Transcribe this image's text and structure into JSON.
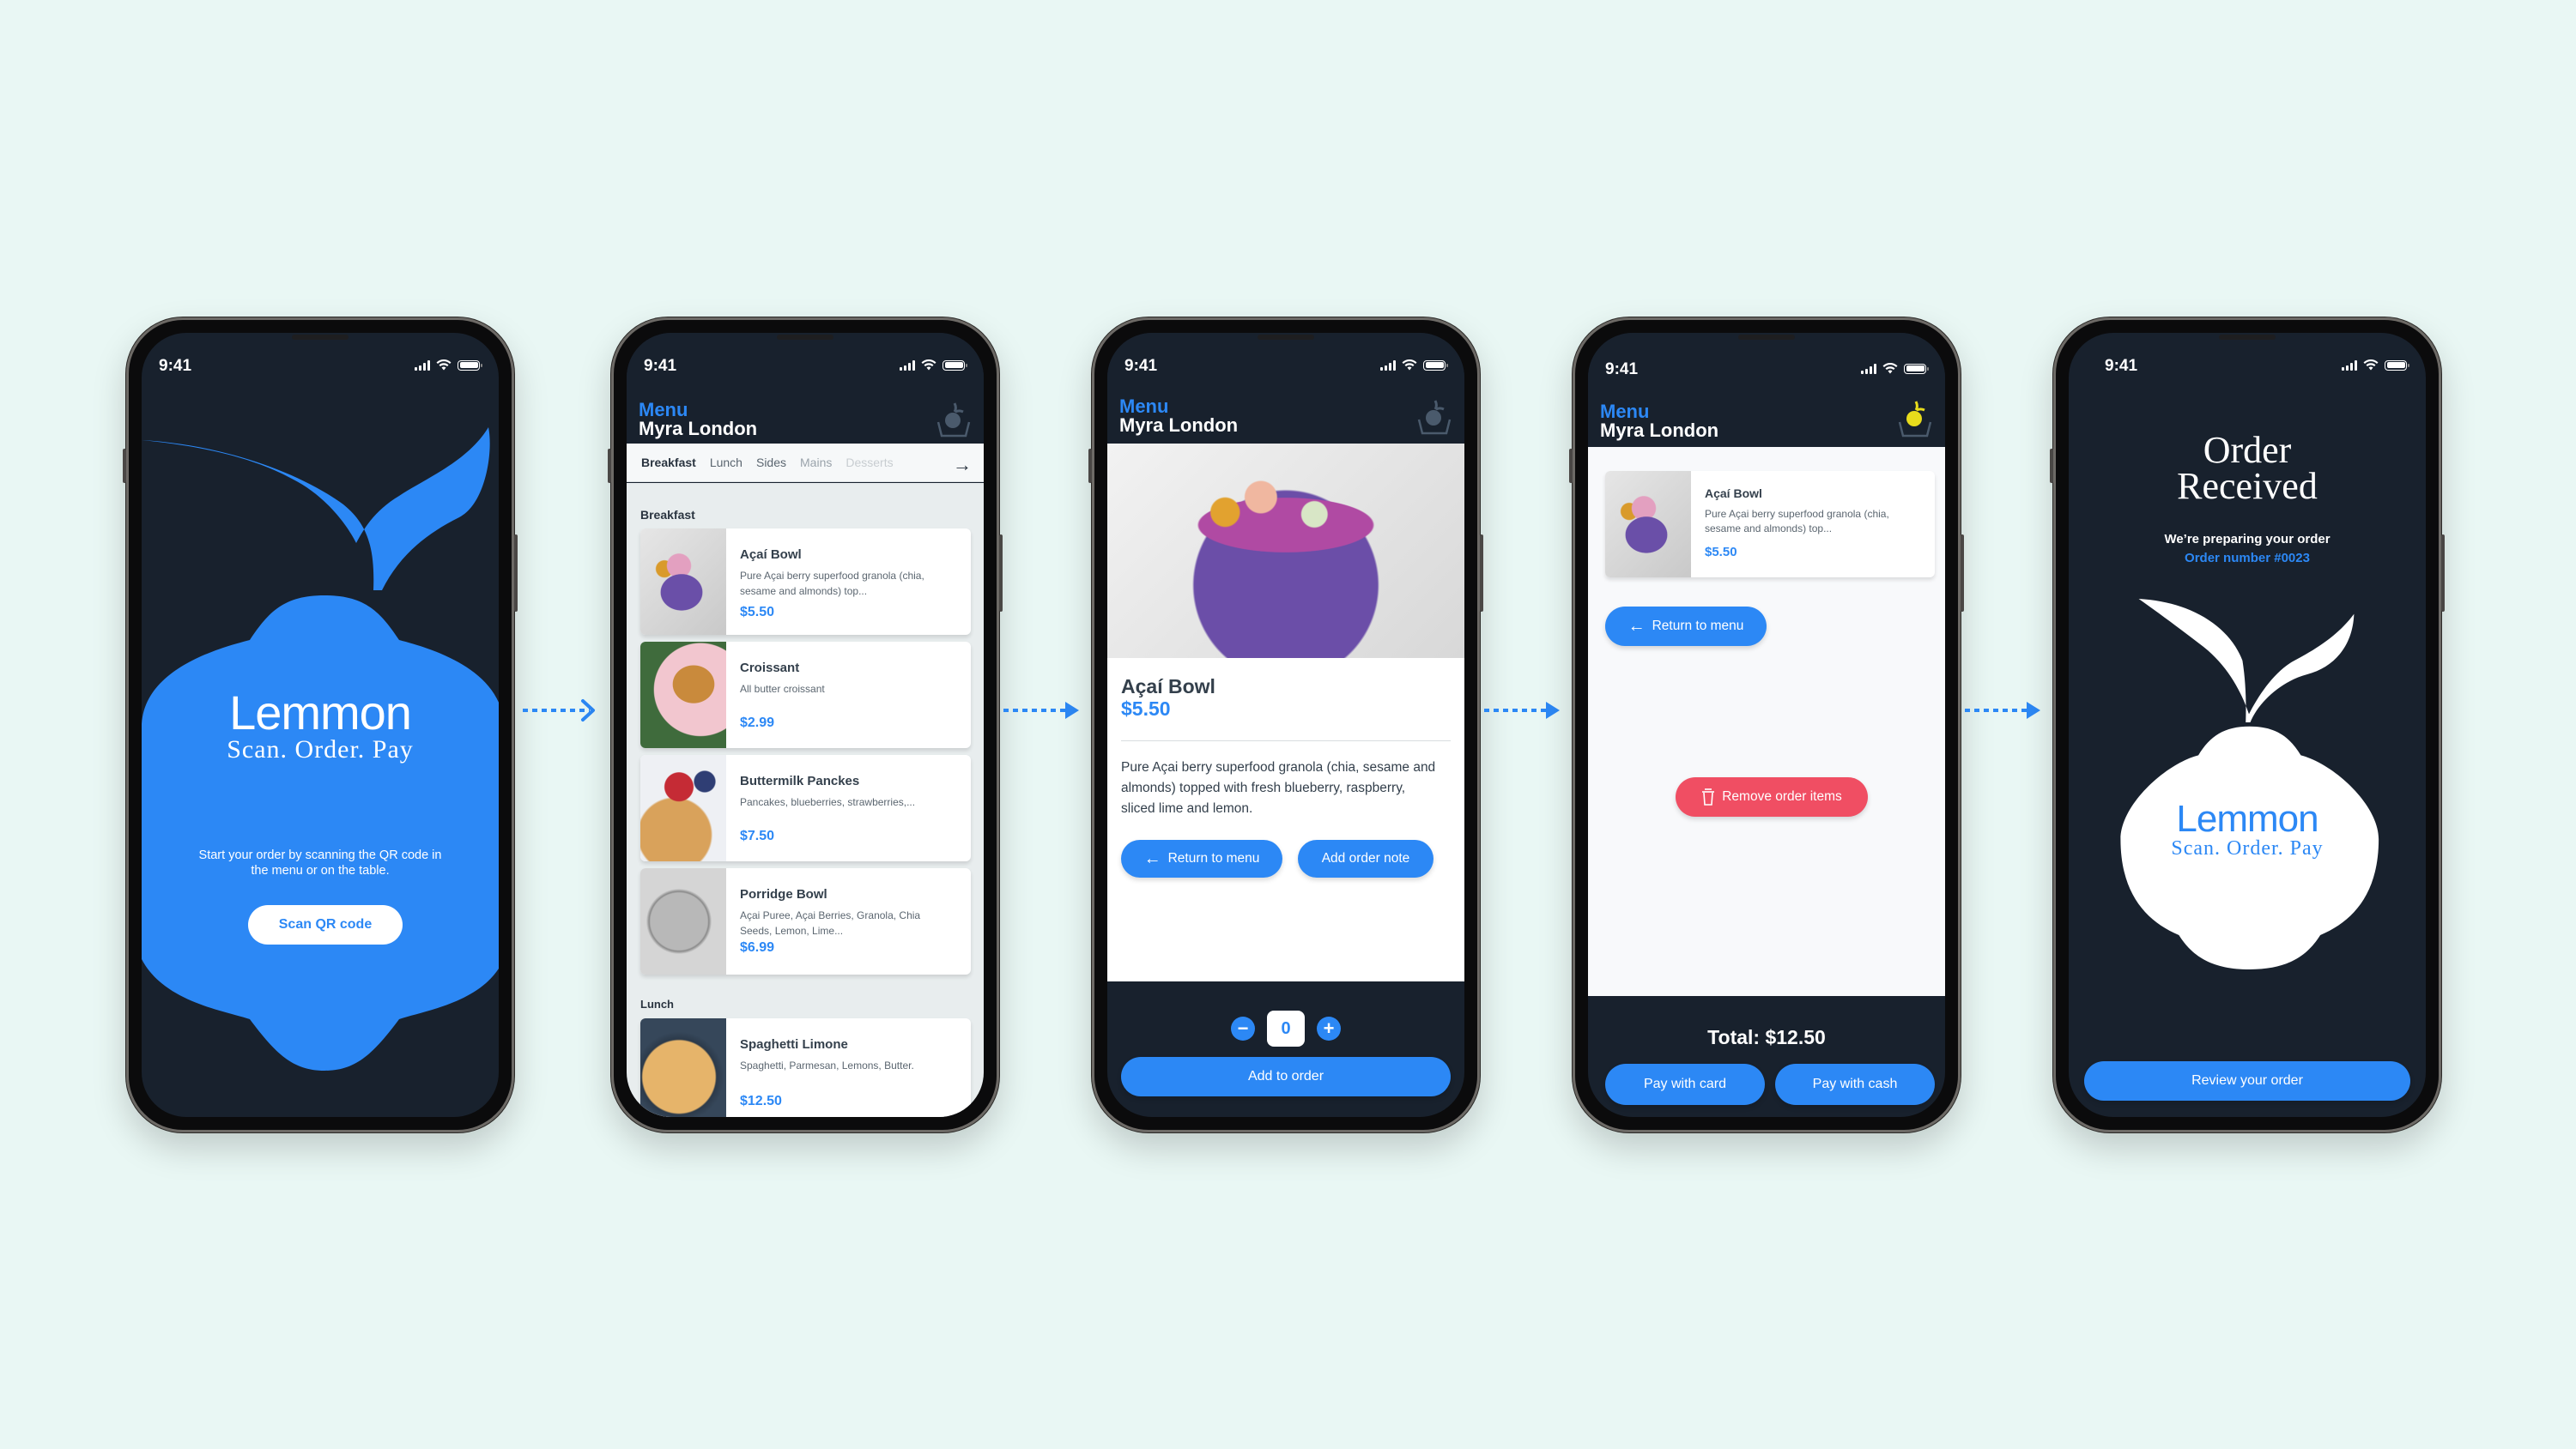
{
  "app": {
    "brand_name": "Lemmon",
    "tagline": "Scan. Order. Pay",
    "accent_color": "#2c88f5",
    "danger_color": "#f04e63",
    "dark_color": "#18212d",
    "background_color": "#e9f7f4"
  },
  "status_bar": {
    "time": "9:41",
    "icons": [
      "signal-icon",
      "wifi-icon",
      "battery-icon"
    ]
  },
  "header": {
    "menu_label": "Menu",
    "restaurant_name": "Myra London",
    "cart_icon": "basket-lemon-icon"
  },
  "screen_welcome": {
    "instructions": "Start your order by scanning the QR code in the menu or on the table.",
    "scan_button": "Scan QR code"
  },
  "screen_menu": {
    "tabs": [
      {
        "label": "Breakfast",
        "active": true
      },
      {
        "label": "Lunch",
        "active": false
      },
      {
        "label": "Sides",
        "active": false
      },
      {
        "label": "Mains",
        "active": false
      },
      {
        "label": "Desserts",
        "active": false
      }
    ],
    "tabs_next_icon": "arrow-right-icon",
    "sections": [
      {
        "title": "Breakfast",
        "items": [
          {
            "name": "Açaí Bowl",
            "description": "Pure Açai berry superfood granola (chia, sesame and almonds) top...",
            "price": "$5.50"
          },
          {
            "name": "Croissant",
            "description": "All butter croissant",
            "price": "$2.99"
          },
          {
            "name": "Buttermilk Panckes",
            "description": "Pancakes, blueberries, strawberries,...",
            "price": "$7.50"
          },
          {
            "name": "Porridge Bowl",
            "description": "Açai Puree, Açai Berries, Granola, Chia Seeds, Lemon, Lime...",
            "price": "$6.99"
          }
        ]
      },
      {
        "title": "Lunch",
        "items": [
          {
            "name": "Spaghetti Limone",
            "description": "Spaghetti, Parmesan, Lemons, Butter.",
            "price": "$12.50"
          }
        ]
      }
    ]
  },
  "screen_item": {
    "name": "Açaí Bowl",
    "price": "$5.50",
    "description": "Pure Açai berry superfood granola (chia, sesame and almonds) topped with fresh blueberry, raspberry, sliced lime and lemon.",
    "return_button": "Return to menu",
    "note_button": "Add order note",
    "quantity": "0",
    "add_button": "Add to order"
  },
  "screen_cart": {
    "item": {
      "name": "Açaí Bowl",
      "description": "Pure Açai berry superfood granola (chia, sesame and almonds) top...",
      "price": "$5.50"
    },
    "return_button": "Return to menu",
    "remove_button": "Remove order items",
    "total_label": "Total: $12.50",
    "pay_card_button": "Pay with card",
    "pay_cash_button": "Pay with cash"
  },
  "screen_confirmation": {
    "title_line1": "Order",
    "title_line2": "Received",
    "subtitle": "We’re preparing your order",
    "order_number": "Order number #0023",
    "review_button": "Review your order"
  }
}
